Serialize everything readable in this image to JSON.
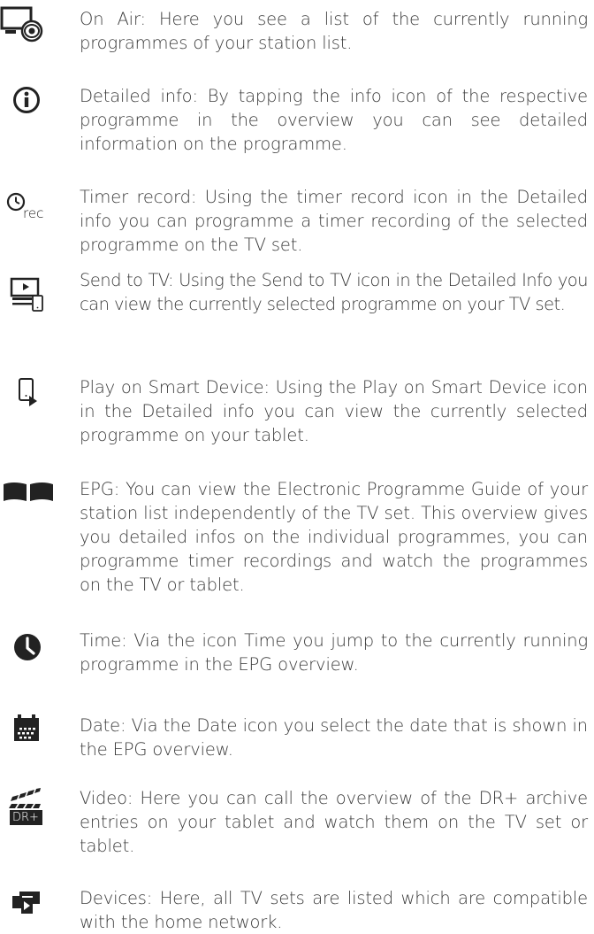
{
  "entries": [
    {
      "icon": "tv-eye-icon",
      "text": "On Air: Here you see a list of the currently running programmes of your station list."
    },
    {
      "icon": "info-icon",
      "text": "Detailed info: By tapping the info icon of the respective programme in the overview you can see detailed information on the programme."
    },
    {
      "icon": "timer-record-icon",
      "icon_label": "rec",
      "text": "Timer record: Using the timer record icon in the Detailed info you can programme a timer recording of the selected programme on the TV set."
    },
    {
      "icon": "send-to-tv-icon",
      "text": "Send to TV: Using the Send to TV icon in the Detailed Info you can view the currently selected programme on your TV set."
    },
    {
      "icon": "play-on-device-icon",
      "text": "Play on Smart Device: Using the Play on Smart Device icon in the Detailed info you can view the currently selected programme on your tablet."
    },
    {
      "icon": "book-icon",
      "text": "EPG: You can view the Electronic Programme Guide of your station list independently of the TV set. This overview gives you detailed infos on the individual programmes, you can programme timer recordings and watch the programmes on the TV or tablet."
    },
    {
      "icon": "clock-icon",
      "text": "Time: Via the icon Time you jump to the currently running programme in the EPG overview."
    },
    {
      "icon": "calendar-icon",
      "text": "Date: Via the Date icon you select the date that is shown in the EPG overview."
    },
    {
      "icon": "dr-plus-video-icon",
      "icon_label": "DR+",
      "text": "Video: Here you can call the overview of the DR+ archive entries on your tablet and watch them on the TV set or tablet."
    },
    {
      "icon": "devices-icon",
      "text": "Devices: Here, all TV sets are listed which are compatible with the home network."
    }
  ]
}
